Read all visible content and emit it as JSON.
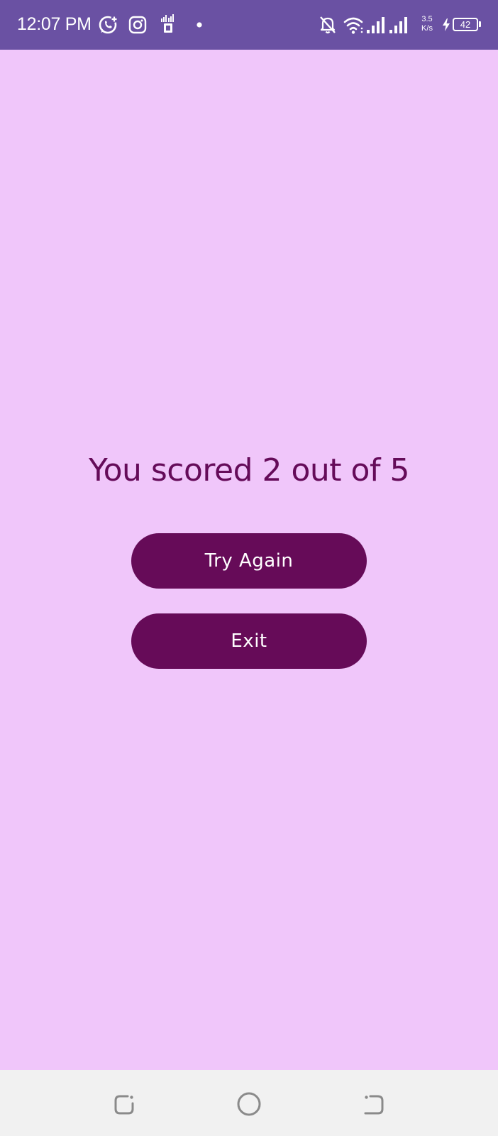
{
  "status_bar": {
    "time": "12:07 PM",
    "net_speed_value": "3.5",
    "net_speed_unit": "K/s",
    "battery_level": "42",
    "icons": [
      "whatsapp-business-icon",
      "instagram-icon",
      "sim-card-icon",
      "notification-dot-icon",
      "notifications-muted-icon",
      "wifi-icon",
      "signal-strength-icon",
      "signal-strength-icon",
      "net-speed-indicator",
      "charging-bolt-icon",
      "battery-icon"
    ]
  },
  "result": {
    "score_text": "You scored 2 out of 5"
  },
  "buttons": {
    "try_again_label": "Try Again",
    "exit_label": "Exit"
  },
  "nav_bar": {
    "icons": [
      "recents-icon",
      "home-icon",
      "back-icon"
    ]
  },
  "colors": {
    "status_bar_bg": "#6a51a3",
    "content_bg": "#f0c6fa",
    "text_accent": "#650b59",
    "button_bg": "#660b58",
    "button_text": "#ffffff",
    "nav_bar_bg": "#f1f1f1",
    "nav_icon": "#8a8a8a"
  }
}
